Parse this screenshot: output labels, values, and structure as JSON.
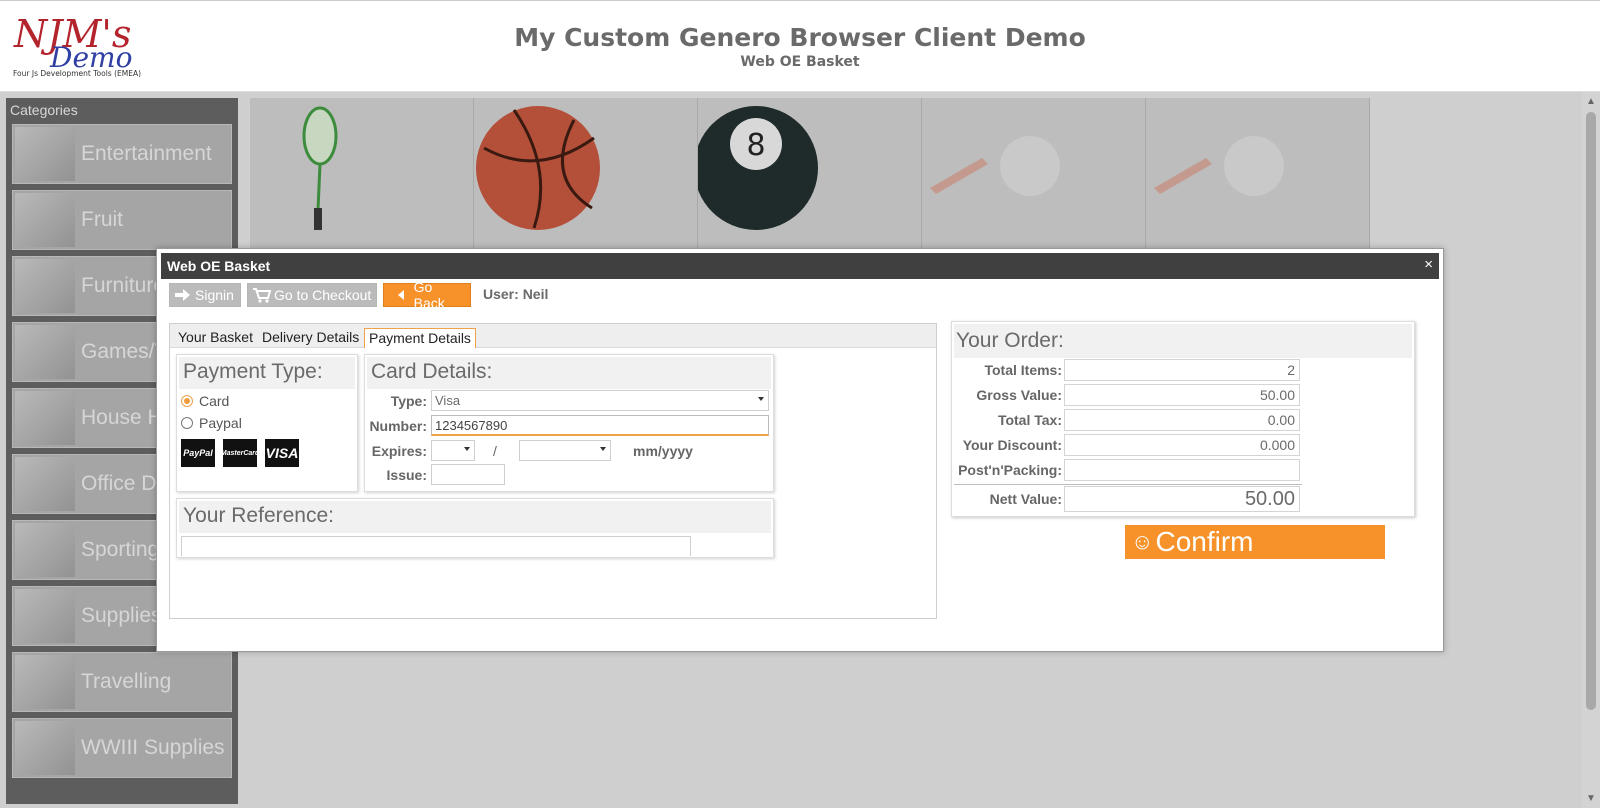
{
  "header": {
    "app_title": "My Custom Genero Browser Client Demo",
    "app_subtitle": "Web OE Basket",
    "logo": {
      "main_text": "NJM's",
      "sub_text": "Demo",
      "tagline": "Four Js Development Tools (EMEA)"
    }
  },
  "sidebar": {
    "title": "Categories",
    "items": [
      {
        "label": "Entertainment"
      },
      {
        "label": "Fruit"
      },
      {
        "label": "Furniture"
      },
      {
        "label": "Games/T"
      },
      {
        "label": "House H"
      },
      {
        "label": "Office D"
      },
      {
        "label": "Sporting"
      },
      {
        "label": "Supplies"
      },
      {
        "label": "Travelling"
      },
      {
        "label": "WWIII Supplies"
      }
    ]
  },
  "products": [
    {
      "icon": "badminton-racket-icon"
    },
    {
      "icon": "basketball-icon"
    },
    {
      "icon": "eight-ball-icon",
      "ball_label": "8"
    },
    {
      "icon": "golf-ball-tee-icon"
    },
    {
      "icon": "golf-ball-tee-icon"
    }
  ],
  "modal": {
    "title": "Web OE Basket",
    "close_label": "×",
    "toolbar": {
      "signin_label": "Signin",
      "checkout_label": "Go to Checkout",
      "goback_label": "Go Back",
      "user_label": "User:",
      "user_name": "Neil"
    },
    "tabs": [
      {
        "label": "Your Basket"
      },
      {
        "label": "Delivery Details"
      },
      {
        "label": "Payment Details"
      }
    ],
    "payment_type": {
      "title": "Payment Type:",
      "options": [
        {
          "label": "Card"
        },
        {
          "label": "Paypal"
        }
      ],
      "logos": [
        "PayPal",
        "MasterCard",
        "VISA"
      ]
    },
    "card_details": {
      "title": "Card Details:",
      "type_label": "Type:",
      "type_value": "Visa",
      "number_label": "Number:",
      "number_value": "1234567890",
      "expires_label": "Expires:",
      "expires_separator": "/",
      "expires_hint": "mm/yyyy",
      "issue_label": "Issue:"
    },
    "reference": {
      "title": "Your Reference:",
      "value": ""
    },
    "order": {
      "title": "Your Order:",
      "rows": [
        {
          "label": "Total Items:",
          "value": "2"
        },
        {
          "label": "Gross Value:",
          "value": "50.00"
        },
        {
          "label": "Total Tax:",
          "value": "0.00"
        },
        {
          "label": "Your Discount:",
          "value": "0.000"
        },
        {
          "label": "Post'n'Packing:",
          "value": ""
        }
      ],
      "nett_label": "Nett Value:",
      "nett_value": "50.00"
    },
    "confirm_label": "Confirm"
  },
  "colors": {
    "accent": "#f7922a",
    "titlebar": "#404040",
    "overlay_grey": "#cfcfcf"
  }
}
